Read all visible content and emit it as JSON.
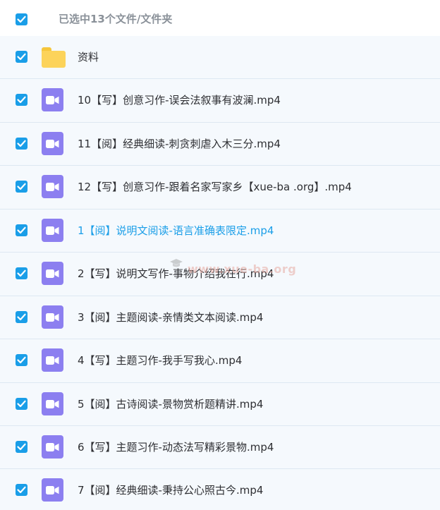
{
  "header": {
    "selection_text": "已选中13个文件/文件夹"
  },
  "files": [
    {
      "name": "资料",
      "type": "folder"
    },
    {
      "name": "10【写】创意习作-误会法叙事有波澜.mp4",
      "type": "video"
    },
    {
      "name": "11【阅】经典细读-刺贪刺虐入木三分.mp4",
      "type": "video"
    },
    {
      "name": "12【写】创意习作-跟着名家写家乡【xue-ba .org】.mp4",
      "type": "video"
    },
    {
      "name": "1【阅】说明文阅读-语言准确表限定.mp4",
      "type": "video",
      "active": true
    },
    {
      "name": "2【写】说明文写作-事物介绍我在行.mp4",
      "type": "video"
    },
    {
      "name": "3【阅】主题阅读-亲情类文本阅读.mp4",
      "type": "video"
    },
    {
      "name": "4【写】主题习作-我手写我心.mp4",
      "type": "video"
    },
    {
      "name": "5【阅】古诗阅读-景物赏析题精讲.mp4",
      "type": "video"
    },
    {
      "name": "6【写】主题习作-动态法写精彩景物.mp4",
      "type": "video"
    },
    {
      "name": "7【阅】经典细读-秉持公心照古今.mp4",
      "type": "video"
    }
  ],
  "watermark": "www.xue-ba.org",
  "colors": {
    "accent": "#1a9ee8",
    "video_icon": "#8c7ff0",
    "folder_icon": "#fcd35a"
  }
}
